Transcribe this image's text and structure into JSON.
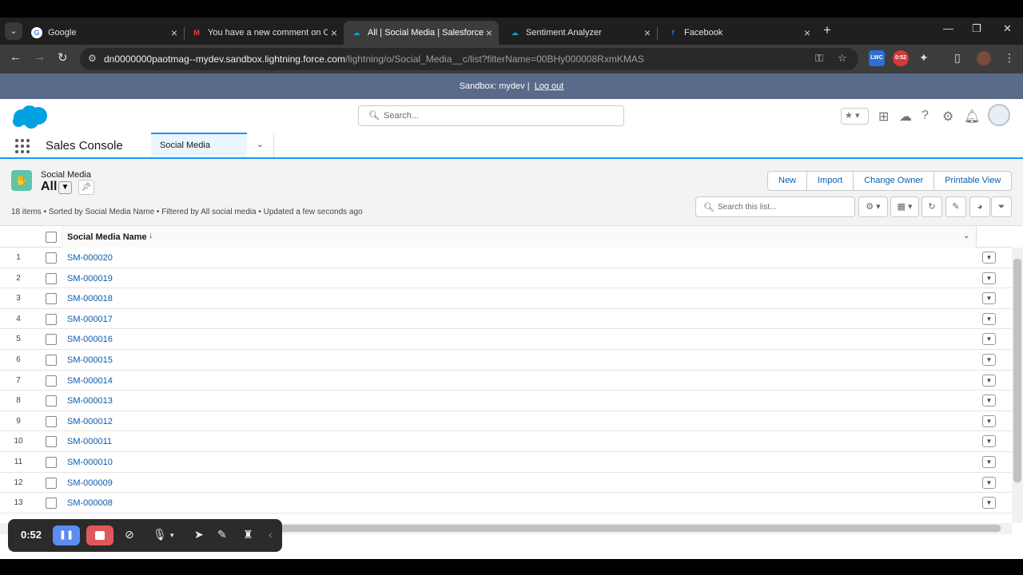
{
  "browser": {
    "tabs": [
      {
        "title": "Google",
        "favicon": "G",
        "color": "#4285f4"
      },
      {
        "title": "You have a new comment on Ch",
        "favicon": "M",
        "color": "#ea4335"
      },
      {
        "title": "All | Social Media | Salesforce",
        "favicon": "☁",
        "color": "#00a1e0"
      },
      {
        "title": "Sentiment Analyzer",
        "favicon": "☁",
        "color": "#00a1e0"
      },
      {
        "title": "Facebook",
        "favicon": "f",
        "color": "#1877f2"
      }
    ],
    "url_host": "dn0000000paotmag--mydev.sandbox.lightning.force.com",
    "url_path": "/lightning/o/Social_Media__c/list?filterName=00BHy000008RxmKMAS",
    "ext_lwc": "LWC",
    "ext_timer": "0:52"
  },
  "sandbox": {
    "text": "Sandbox: mydev |",
    "logout": "Log out"
  },
  "header": {
    "search_placeholder": "Search..."
  },
  "nav": {
    "app_name": "Sales Console",
    "tab": "Social Media"
  },
  "list": {
    "object_label": "Social Media",
    "view_name": "All",
    "meta": "18 items • Sorted by Social Media Name • Filtered by All social media • Updated a few seconds ago",
    "buttons": [
      "New",
      "Import",
      "Change Owner",
      "Printable View"
    ],
    "search_placeholder": "Search this list...",
    "column_header": "Social Media Name",
    "rows": [
      {
        "num": "1",
        "name": "SM-000020"
      },
      {
        "num": "2",
        "name": "SM-000019"
      },
      {
        "num": "3",
        "name": "SM-000018"
      },
      {
        "num": "4",
        "name": "SM-000017"
      },
      {
        "num": "5",
        "name": "SM-000016"
      },
      {
        "num": "6",
        "name": "SM-000015"
      },
      {
        "num": "7",
        "name": "SM-000014"
      },
      {
        "num": "8",
        "name": "SM-000013"
      },
      {
        "num": "9",
        "name": "SM-000012"
      },
      {
        "num": "10",
        "name": "SM-000011"
      },
      {
        "num": "11",
        "name": "SM-000010"
      },
      {
        "num": "12",
        "name": "SM-000009"
      },
      {
        "num": "13",
        "name": "SM-000008"
      }
    ]
  },
  "recorder": {
    "time": "0:52"
  },
  "colors": {
    "brand": "#00a1e0",
    "link": "#0b5cab",
    "accent": "#1b96ff",
    "sandbox_bar": "#5a6a8a"
  }
}
